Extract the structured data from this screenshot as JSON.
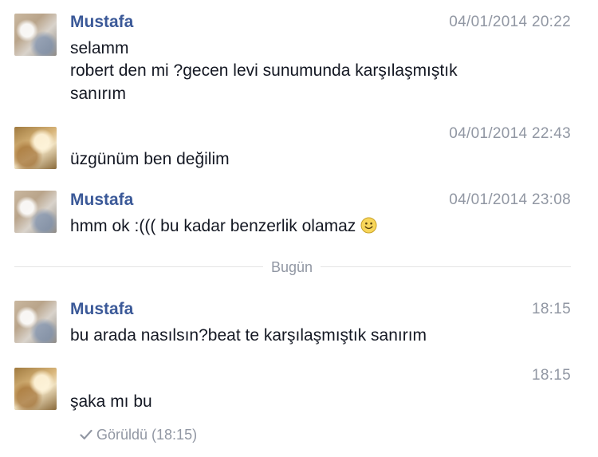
{
  "conversation": {
    "messages": [
      {
        "sender": "Mustafa",
        "timestamp": "04/01/2014 20:22",
        "lines": [
          "selamm",
          "robert den mi ?gecen levi sunumunda karşılaşmıştık",
          "sanırım"
        ]
      },
      {
        "sender": "",
        "timestamp": "04/01/2014 22:43",
        "lines": [
          "üzgünüm ben değilim"
        ]
      },
      {
        "sender": "Mustafa",
        "timestamp": "04/01/2014 23:08",
        "lines": [
          "hmm ok :((( bu kadar benzerlik olamaz"
        ],
        "emoji": "smiley-icon"
      },
      {
        "sender": "Mustafa",
        "timestamp": "18:15",
        "lines": [
          "bu arada nasılsın?beat te karşılaşmıştık sanırım"
        ]
      },
      {
        "sender": "",
        "timestamp": "18:15",
        "lines": [
          "şaka mı bu"
        ]
      }
    ],
    "day_divider": "Bugün",
    "seen_status": "Görüldü (18:15)"
  },
  "colors": {
    "sender_name": "#3b5998",
    "timestamp": "#9197a3",
    "message_text": "#141823",
    "divider": "#e5e5e5"
  }
}
